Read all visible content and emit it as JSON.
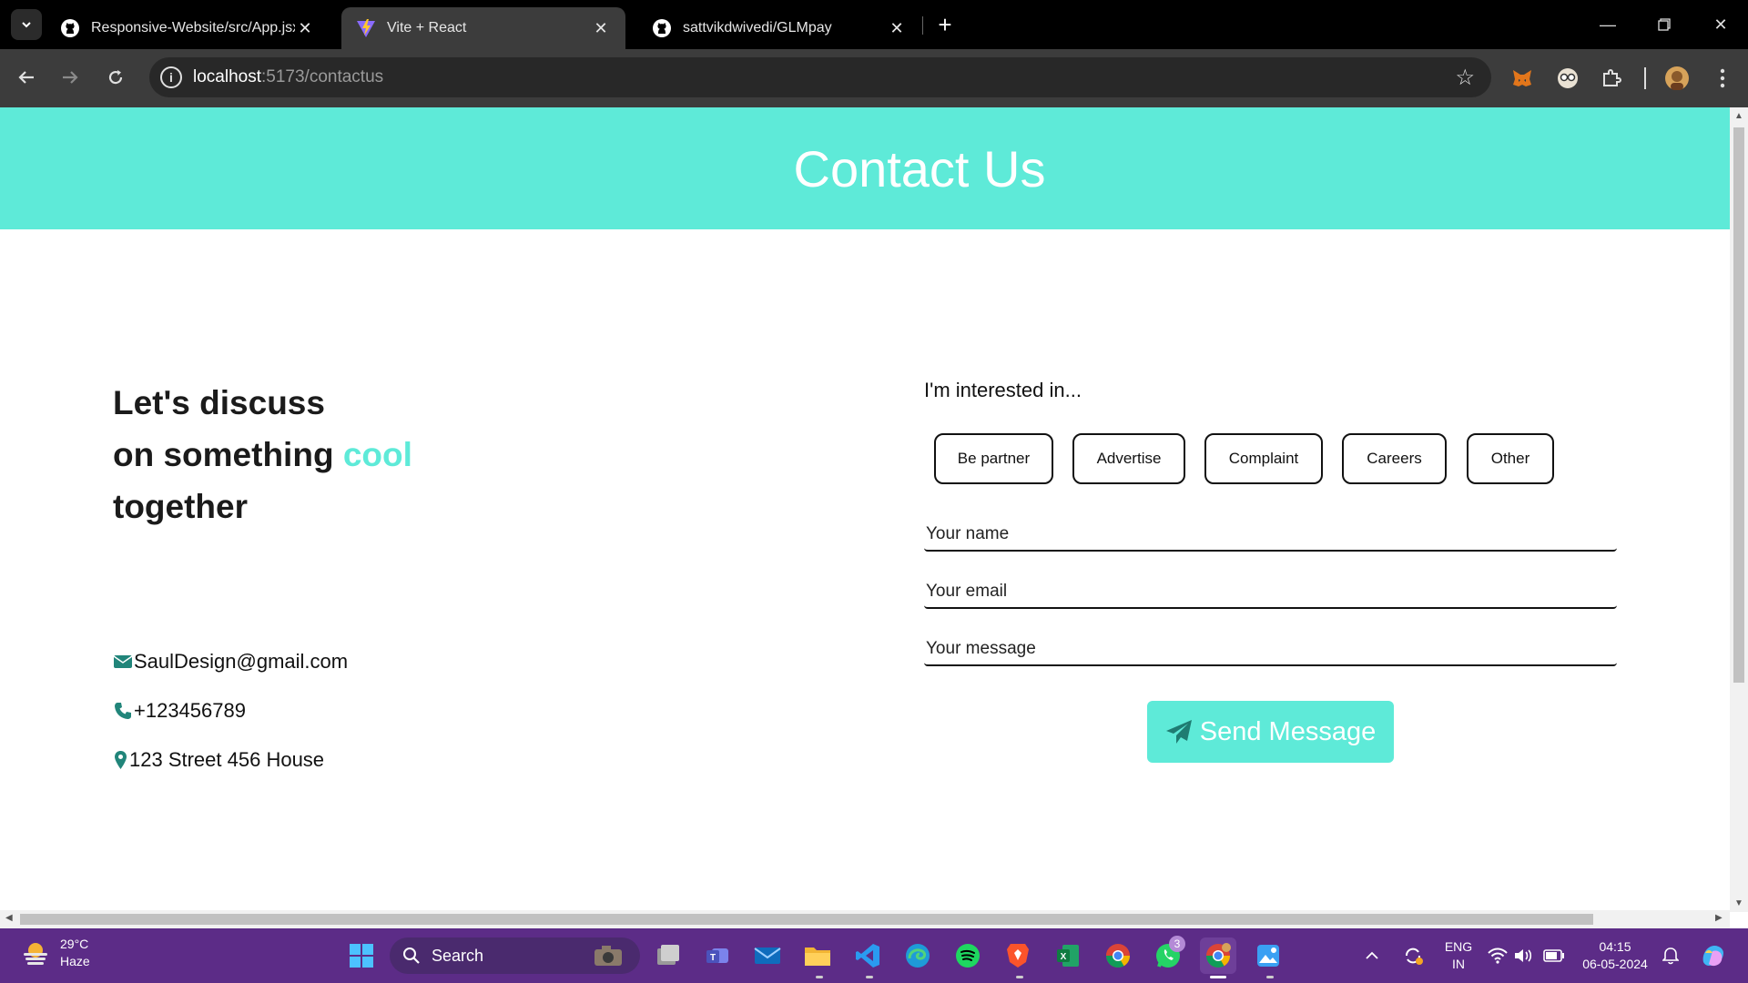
{
  "browser": {
    "tabs": [
      {
        "title": "Responsive-Website/src/App.jsx",
        "icon": "github-icon",
        "active": false
      },
      {
        "title": "Vite + React",
        "icon": "vite-icon",
        "active": true
      },
      {
        "title": "sattvikdwivedi/GLMpay",
        "icon": "github-icon",
        "active": false
      }
    ],
    "url_host": "localhost",
    "url_path": ":5173/contactus"
  },
  "page": {
    "title": "Contact Us",
    "tagline": {
      "line1": "Let's discuss",
      "line2_prefix": "on something ",
      "line2_accent": "cool",
      "line3": "together"
    },
    "contact": {
      "email": "SaulDesign@gmail.com",
      "phone": "+123456789",
      "address": "123 Street 456 House"
    },
    "form": {
      "interest_label": "I'm interested in...",
      "options": [
        "Be partner",
        "Advertise",
        "Complaint",
        "Careers",
        "Other"
      ],
      "name_placeholder": "Your name",
      "email_placeholder": "Your email",
      "message_placeholder": "Your message",
      "submit_label": "Send Message"
    }
  },
  "taskbar": {
    "weather_temp": "29°C",
    "weather_desc": "Haze",
    "search_label": "Search",
    "lang_line1": "ENG",
    "lang_line2": "IN",
    "time": "04:15",
    "date": "06-05-2024",
    "whatsapp_badge": "3"
  },
  "colors": {
    "accent": "#5eead8",
    "taskbar": "#5c2c87",
    "chrome_dark": "#000000",
    "toolbar": "#3c3c3c"
  }
}
